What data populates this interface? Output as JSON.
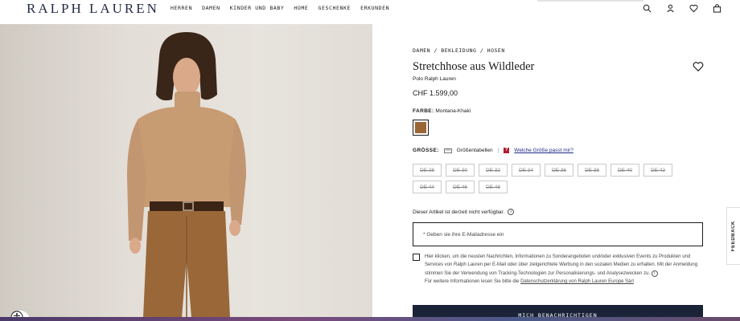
{
  "header": {
    "logo": "RALPH LAUREN",
    "nav": [
      "HERREN",
      "DAMEN",
      "KINDER UND BABY",
      "HOME",
      "GESCHENKE",
      "ERKUNDEN"
    ],
    "icons": [
      "search-icon",
      "user-icon",
      "heart-icon",
      "bag-icon"
    ]
  },
  "product": {
    "breadcrumb": "DAMEN / BEKLEIDUNG / HOSEN",
    "title": "Stretchhose aus Wildleder",
    "brand": "Polo Ralph Lauren",
    "price": "CHF 1.599,00",
    "color_label": "FARBE:",
    "color_value": "Montana-Khaki",
    "swatch_color": "#9a6636"
  },
  "sizes": {
    "label": "GRÖSSE:",
    "chart_link": "Größentabellen",
    "fit_link": "Welche Größe passt mir?",
    "options": [
      "DE 28",
      "DE 30",
      "DE 32",
      "DE 34",
      "DE 36",
      "DE 38",
      "DE 40",
      "DE 42",
      "DE 44",
      "DE 46",
      "DE 48"
    ]
  },
  "availability": {
    "message": "Dieser Artikel ist derzeit nicht verfügbar.",
    "email_placeholder": "* Geben sie ihre E-Mailadresse ein",
    "consent_text": "Hier klicken, um die neusten Nachrichten, Informationen zu Sonderangeboten und/oder exklusiven Events zu Produkten und Services von Ralph Lauren per E-Mail oder über zielgerichtete Werbung in den sozialen Medien zu erhalten. Mit der Anmeldung stimmen Sie der Verwendung von Tracking-Technologien zur Personalisierungs- und Analysezwecken zu.",
    "privacy_prefix": "Für weitere Informationen lesen Sie bitte die",
    "privacy_link": "Datenschutzerklärung von Ralph Lauren Europe Sàrl",
    "notify_button": "MICH BENACHRICHTIGEN"
  },
  "feedback": "FEEDBACK",
  "colors": {
    "navy": "#1a2338",
    "logo": "#1f2a44",
    "alert": "#b01c2e"
  }
}
